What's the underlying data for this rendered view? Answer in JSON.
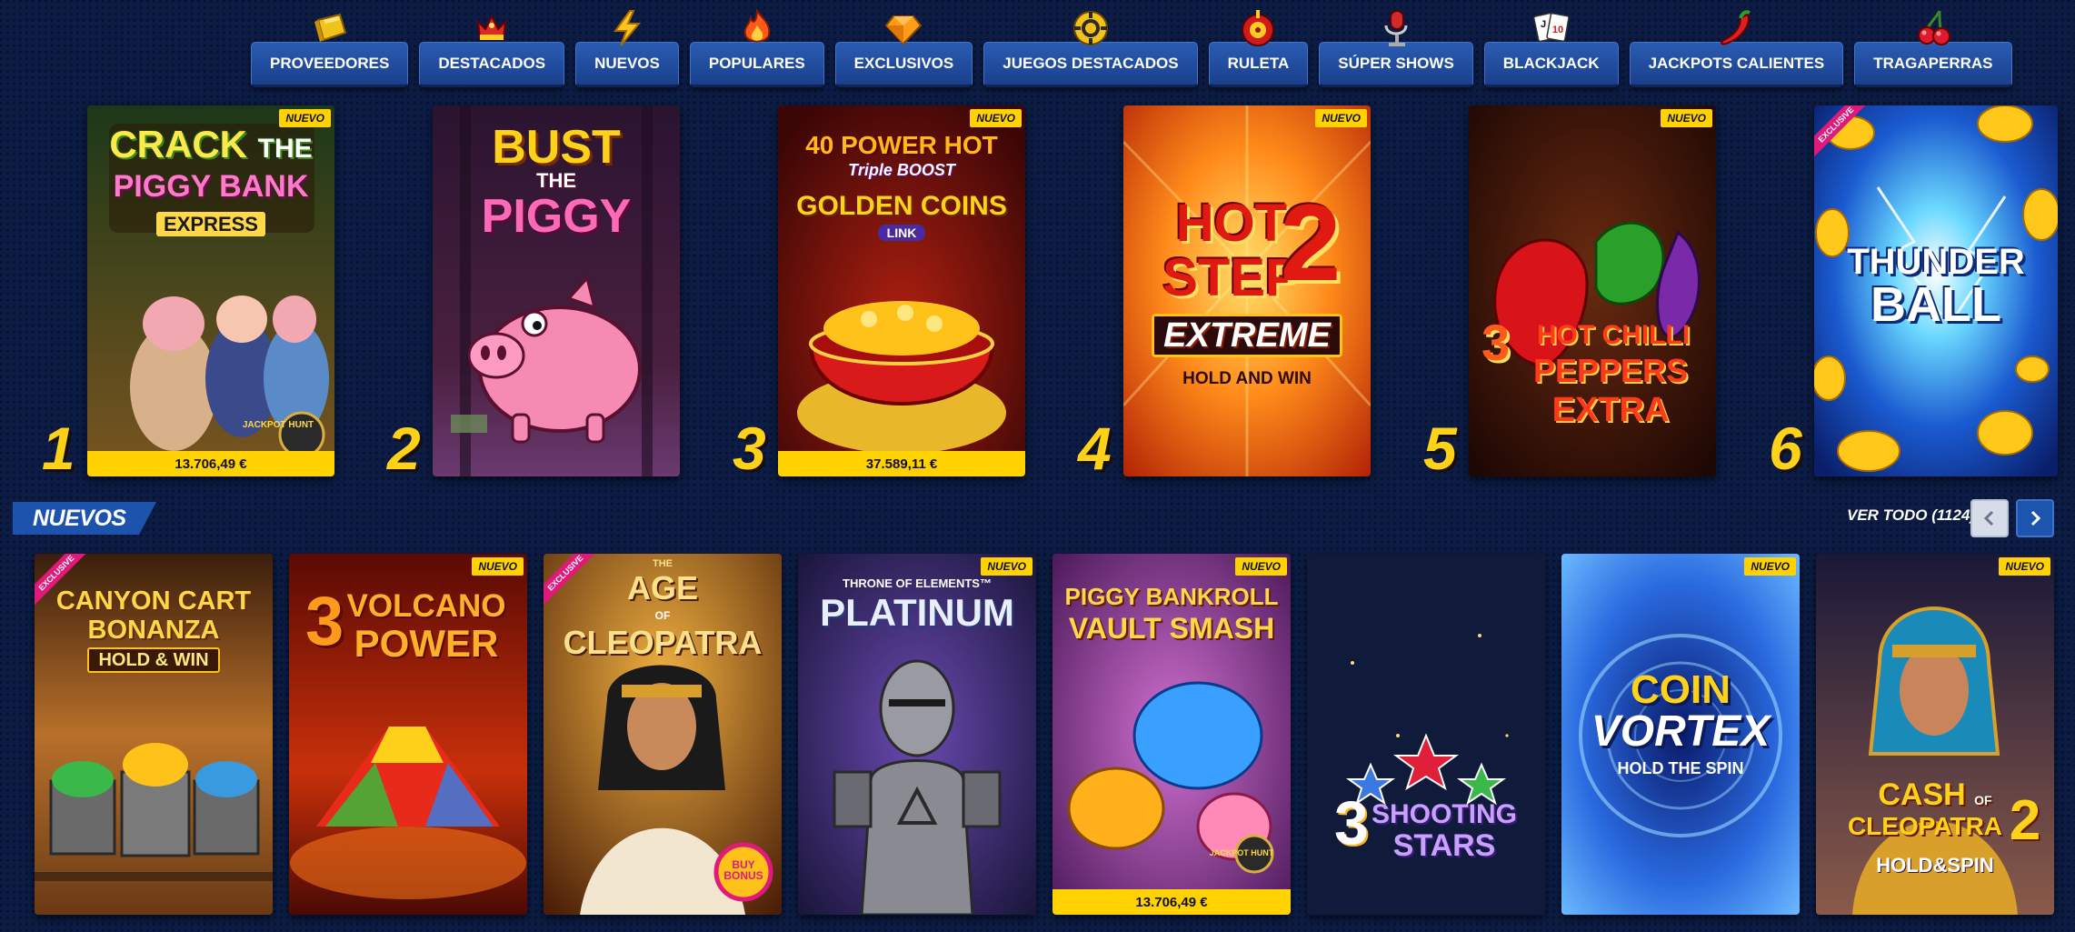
{
  "categories": [
    {
      "label": "PROVEEDORES",
      "icon": "gold-bar-icon"
    },
    {
      "label": "DESTACADOS",
      "icon": "crown-icon"
    },
    {
      "label": "NUEVOS",
      "icon": "lightning-icon"
    },
    {
      "label": "POPULARES",
      "icon": "fire-icon"
    },
    {
      "label": "EXCLUSIVOS",
      "icon": "diamond-icon"
    },
    {
      "label": "JUEGOS DESTACADOS",
      "icon": "poker-chip-icon"
    },
    {
      "label": "RULETA",
      "icon": "roulette-icon"
    },
    {
      "label": "SÚPER SHOWS",
      "icon": "microphone-icon"
    },
    {
      "label": "BLACKJACK",
      "icon": "playing-cards-icon"
    },
    {
      "label": "JACKPOTS CALIENTES",
      "icon": "chili-icon"
    },
    {
      "label": "TRAGAPERRAS",
      "icon": "cherries-icon"
    }
  ],
  "top_games": [
    {
      "rank": "1",
      "title": [
        "CRACK",
        "THE",
        "PIGGY BANK",
        "EXPRESS"
      ],
      "badge": "NUEVO",
      "jackpot": "13.706,49 €",
      "logo": "JACKPOT HUNT",
      "colors": [
        "#1f3a1a",
        "#6b4a1a"
      ]
    },
    {
      "rank": "2",
      "title": [
        "BUST",
        "THE",
        "PIGGY"
      ],
      "badge": "",
      "jackpot": "",
      "colors": [
        "#2c1530",
        "#5a2a48"
      ]
    },
    {
      "rank": "3",
      "title": [
        "40 POWER HOT",
        "Triple BOOST",
        "GOLDEN COINS",
        "LINK"
      ],
      "badge": "NUEVO",
      "jackpot": "37.589,11 €",
      "colors": [
        "#3a0a0a",
        "#8a1a10"
      ]
    },
    {
      "rank": "4",
      "title": [
        "HOT",
        "STEP",
        "2",
        "EXTREME",
        "HOLD AND WIN"
      ],
      "badge": "NUEVO",
      "jackpot": "",
      "colors": [
        "#ffb12a",
        "#c83408"
      ]
    },
    {
      "rank": "5",
      "title": [
        "3",
        "HOT CHILLI",
        "PEPPERS",
        "EXTRA"
      ],
      "badge": "NUEVO",
      "jackpot": "",
      "colors": [
        "#2a0a06",
        "#5a1a0e"
      ]
    },
    {
      "rank": "6",
      "title": [
        "THUNDER",
        "BALL"
      ],
      "badge": "EXCLUSIVE",
      "jackpot": "",
      "colors": [
        "#0a3a9a",
        "#1a7ae0"
      ]
    }
  ],
  "nuevos": {
    "title": "NUEVOS",
    "ver_todo": "VER TODO (1124)",
    "games": [
      {
        "title": [
          "CANYON CART",
          "BONANZA",
          "HOLD & WIN"
        ],
        "badge": "EXCLUSIVE",
        "jackpot": "",
        "colors": [
          "#6a3a16",
          "#d8943c"
        ]
      },
      {
        "title": [
          "3",
          "VOLCANO",
          "POWER"
        ],
        "badge": "NUEVO",
        "jackpot": "",
        "colors": [
          "#6a1006",
          "#d0360e"
        ]
      },
      {
        "title": [
          "THE",
          "AGE",
          "OF",
          "CLEOPATRA"
        ],
        "badge": "EXCLUSIVE",
        "jackpot": "",
        "colors": [
          "#5a2a0a",
          "#c87a24"
        ]
      },
      {
        "title": [
          "THRONE OF ELEMENTS™",
          "PLATINUM"
        ],
        "badge": "NUEVO",
        "jackpot": "",
        "colors": [
          "#181838",
          "#40306a"
        ]
      },
      {
        "title": [
          "PIGGY BANKROLL",
          "VAULT SMASH"
        ],
        "badge": "NUEVO",
        "jackpot": "13.706,49 €",
        "logo": "JACKPOT HUNT",
        "colors": [
          "#5a1a6a",
          "#b050c0"
        ]
      },
      {
        "title": [
          "3",
          "SHOOTING",
          "STARS"
        ],
        "badge": "",
        "jackpot": "",
        "colors": [
          "#0c1838",
          "#141f40"
        ]
      },
      {
        "title": [
          "COIN",
          "VORTEX",
          "HOLD THE SPIN"
        ],
        "badge": "NUEVO",
        "jackpot": "",
        "colors": [
          "#0a2a8a",
          "#2a7ae8"
        ]
      },
      {
        "title": [
          "CASH",
          "OF",
          "CLEOPATRA",
          "2",
          "HOLD&SPIN"
        ],
        "badge": "NUEVO",
        "jackpot": "",
        "colors": [
          "#2a1a4a",
          "#7a4a6a"
        ]
      }
    ]
  },
  "badge_labels": {
    "nuevo": "NUEVO",
    "exclusive": "EXCLUSIVE",
    "buy_bonus": "BUY BONUS"
  },
  "accent": "#ffd200"
}
